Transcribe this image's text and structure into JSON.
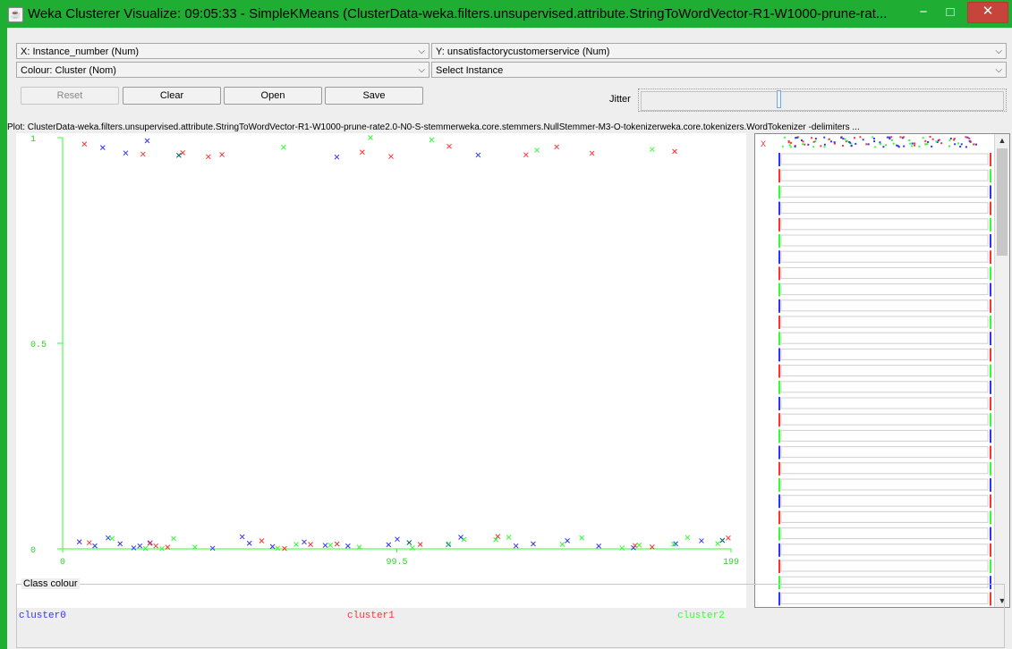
{
  "window": {
    "title": "Weka Clusterer Visualize: 09:05:33 - SimpleKMeans (ClusterData-weka.filters.unsupervised.attribute.StringToWordVector-R1-W1000-prune-rat...",
    "minimize_glyph": "−",
    "maximize_glyph": "□",
    "close_glyph": "✕"
  },
  "controls": {
    "x_axis": "X: Instance_number (Num)",
    "y_axis": "Y: unsatisfactorycustomerservice (Num)",
    "colour": "Colour: Cluster (Nom)",
    "select_instance": "Select Instance",
    "reset": "Reset",
    "clear": "Clear",
    "open": "Open",
    "save": "Save",
    "jitter": "Jitter",
    "jitter_level": 0.38
  },
  "plot_title": "Plot: ClusterData-weka.filters.unsupervised.attribute.StringToWordVector-R1-W1000-prune-rate2.0-N0-S-stemmerweka.core.stemmers.NullStemmer-M3-O-tokenizerweka.core.tokenizers.WordTokenizer -delimiters ...",
  "side_panel": {
    "label": "X"
  },
  "class_colour": {
    "title": "Class colour",
    "clusters": [
      {
        "name": "cluster0",
        "color": "#3232ff"
      },
      {
        "name": "cluster1",
        "color": "#ff3232"
      },
      {
        "name": "cluster2",
        "color": "#32ff32"
      }
    ]
  },
  "colors": {
    "axis": "#32ff32",
    "axis_label": "#32cd32"
  },
  "chart_data": {
    "type": "scatter",
    "title": "",
    "xlabel": "Instance_number",
    "ylabel": "unsatisfactorycustomerservice",
    "xlim": [
      0,
      199
    ],
    "ylim": [
      0,
      1
    ],
    "x_ticks": [
      "0",
      "99.5",
      "199"
    ],
    "y_ticks": [
      "1",
      "0.5",
      "0"
    ],
    "marker": "x",
    "series": [
      {
        "name": "cluster0",
        "color": "#3232ff",
        "points": [
          [
            5,
            0
          ],
          [
            10,
            0
          ],
          [
            12,
            1
          ],
          [
            14,
            0
          ],
          [
            17,
            0
          ],
          [
            19,
            1
          ],
          [
            21,
            0
          ],
          [
            23,
            0
          ],
          [
            25,
            1
          ],
          [
            26,
            0
          ],
          [
            45,
            0
          ],
          [
            53,
            0
          ],
          [
            56,
            0
          ],
          [
            62,
            0
          ],
          [
            72,
            0
          ],
          [
            78,
            0
          ],
          [
            82,
            1
          ],
          [
            85,
            0
          ],
          [
            97,
            0
          ],
          [
            100,
            0
          ],
          [
            115,
            0
          ],
          [
            119,
            0
          ],
          [
            124,
            1
          ],
          [
            135,
            0
          ],
          [
            140,
            0
          ],
          [
            150,
            0
          ],
          [
            160,
            0
          ],
          [
            170,
            0
          ],
          [
            183,
            0
          ],
          [
            190,
            0
          ]
        ]
      },
      {
        "name": "cluster1",
        "color": "#ff3232",
        "points": [
          [
            6,
            1
          ],
          [
            8,
            0
          ],
          [
            24,
            1
          ],
          [
            26,
            0
          ],
          [
            28,
            0
          ],
          [
            31,
            0
          ],
          [
            36,
            1
          ],
          [
            43,
            1
          ],
          [
            47,
            1
          ],
          [
            59,
            0
          ],
          [
            66,
            0
          ],
          [
            74,
            0
          ],
          [
            82,
            0
          ],
          [
            89,
            1
          ],
          [
            98,
            1
          ],
          [
            107,
            0
          ],
          [
            115,
            1
          ],
          [
            130,
            0
          ],
          [
            138,
            1
          ],
          [
            147,
            1
          ],
          [
            158,
            1
          ],
          [
            170,
            0
          ],
          [
            176,
            0
          ],
          [
            182,
            1
          ],
          [
            198,
            0
          ]
        ]
      },
      {
        "name": "cluster2",
        "color": "#32ff32",
        "points": [
          [
            15,
            0
          ],
          [
            25,
            0
          ],
          [
            30,
            0
          ],
          [
            33,
            0
          ],
          [
            39,
            0
          ],
          [
            64,
            0
          ],
          [
            66,
            1
          ],
          [
            70,
            0
          ],
          [
            80,
            0
          ],
          [
            88,
            0
          ],
          [
            92,
            1
          ],
          [
            104,
            0
          ],
          [
            110,
            1
          ],
          [
            115,
            0
          ],
          [
            120,
            0
          ],
          [
            129,
            0
          ],
          [
            133,
            0
          ],
          [
            141,
            1
          ],
          [
            149,
            0
          ],
          [
            155,
            0
          ],
          [
            167,
            0
          ],
          [
            172,
            0
          ],
          [
            176,
            1
          ],
          [
            182,
            0
          ],
          [
            186,
            0
          ],
          [
            195,
            0
          ]
        ]
      },
      {
        "name": "cluster_dark",
        "color": "#006060",
        "points": [
          [
            35,
            1
          ],
          [
            103,
            0
          ],
          [
            196,
            0
          ]
        ]
      }
    ]
  }
}
